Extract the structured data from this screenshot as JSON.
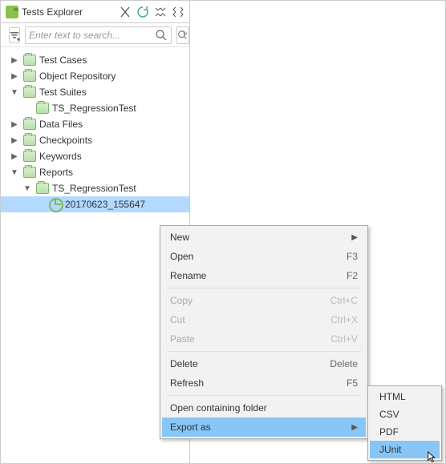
{
  "header": {
    "title": "Tests Explorer"
  },
  "search": {
    "placeholder": "Enter text to search..."
  },
  "tree": {
    "items": [
      {
        "label": "Test Cases"
      },
      {
        "label": "Object Repository"
      },
      {
        "label": "Test Suites"
      },
      {
        "label": "TS_RegressionTest"
      },
      {
        "label": "Data Files"
      },
      {
        "label": "Checkpoints"
      },
      {
        "label": "Keywords"
      },
      {
        "label": "Reports"
      },
      {
        "label": "TS_RegressionTest"
      },
      {
        "label": "20170623_155647"
      }
    ]
  },
  "context_menu": {
    "new": "New",
    "open": "Open",
    "open_sc": "F3",
    "rename": "Rename",
    "rename_sc": "F2",
    "copy": "Copy",
    "copy_sc": "Ctrl+C",
    "cut": "Cut",
    "cut_sc": "Ctrl+X",
    "paste": "Paste",
    "paste_sc": "Ctrl+V",
    "delete": "Delete",
    "delete_sc": "Delete",
    "refresh": "Refresh",
    "refresh_sc": "F5",
    "open_folder": "Open containing folder",
    "export_as": "Export as"
  },
  "submenu": {
    "html": "HTML",
    "csv": "CSV",
    "pdf": "PDF",
    "junit": "JUnit"
  }
}
